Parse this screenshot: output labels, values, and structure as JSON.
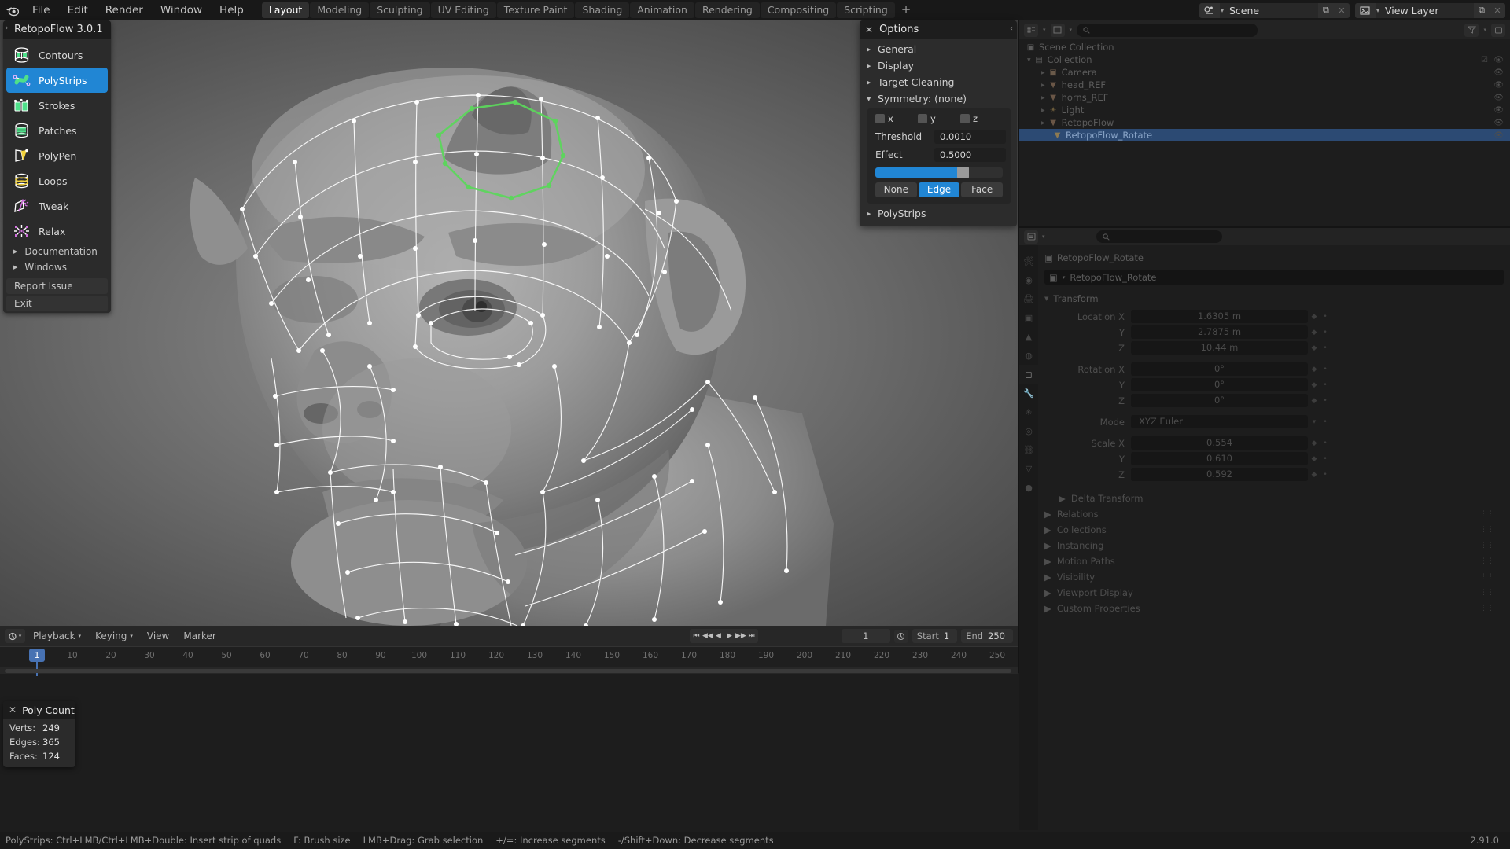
{
  "app": {
    "version": "2.91.0"
  },
  "topbar": {
    "logo_icon": "blender-logo-icon",
    "menus": [
      "File",
      "Edit",
      "Render",
      "Window",
      "Help"
    ],
    "workspace_tabs": [
      {
        "label": "Layout",
        "active": true
      },
      {
        "label": "Modeling",
        "active": false
      },
      {
        "label": "Sculpting",
        "active": false
      },
      {
        "label": "UV Editing",
        "active": false
      },
      {
        "label": "Texture Paint",
        "active": false
      },
      {
        "label": "Shading",
        "active": false
      },
      {
        "label": "Animation",
        "active": false
      },
      {
        "label": "Rendering",
        "active": false
      },
      {
        "label": "Compositing",
        "active": false
      },
      {
        "label": "Scripting",
        "active": false
      }
    ],
    "add_tab_label": "+",
    "scene": {
      "icon": "scene-icon",
      "name": "Scene",
      "copy_icon": "duplicate-icon",
      "close_icon": "x-icon"
    },
    "view_layer": {
      "icon": "view-layer-icon",
      "name": "View Layer",
      "copy_icon": "duplicate-icon",
      "close_icon": "x-icon"
    }
  },
  "retopoflow": {
    "title": "RetopoFlow 3.0.1",
    "tools": [
      {
        "label": "Contours",
        "icon": "contours-icon",
        "active": false
      },
      {
        "label": "PolyStrips",
        "icon": "polystrips-icon",
        "active": true
      },
      {
        "label": "Strokes",
        "icon": "strokes-icon",
        "active": false
      },
      {
        "label": "Patches",
        "icon": "patches-icon",
        "active": false
      },
      {
        "label": "PolyPen",
        "icon": "polypen-icon",
        "active": false
      },
      {
        "label": "Loops",
        "icon": "loops-icon",
        "active": false
      },
      {
        "label": "Tweak",
        "icon": "tweak-icon",
        "active": false
      },
      {
        "label": "Relax",
        "icon": "relax-icon",
        "active": false
      }
    ],
    "sections": [
      {
        "label": "Documentation",
        "icon": "triangle-right-icon"
      },
      {
        "label": "Windows",
        "icon": "triangle-right-icon"
      }
    ],
    "actions": [
      "Report Issue",
      "Exit"
    ]
  },
  "options": {
    "title": "Options",
    "close_icon": "x-icon",
    "collapse_icon": "chevron-left-icon",
    "sections": [
      {
        "label": "General",
        "expanded": false
      },
      {
        "label": "Display",
        "expanded": false
      },
      {
        "label": "Target Cleaning",
        "expanded": false
      },
      {
        "label": "Symmetry: (none)",
        "expanded": true
      }
    ],
    "symmetry": {
      "axes": [
        {
          "label": "x",
          "checked": false
        },
        {
          "label": "y",
          "checked": false
        },
        {
          "label": "z",
          "checked": false
        }
      ],
      "threshold_label": "Threshold",
      "threshold_value": "0.0010",
      "effect_label": "Effect",
      "effect_value": "0.5000",
      "slider_percent": 66,
      "mode_buttons": [
        {
          "label": "None",
          "active": false
        },
        {
          "label": "Edge",
          "active": true
        },
        {
          "label": "Face",
          "active": false
        }
      ]
    },
    "footer_section": {
      "label": "PolyStrips",
      "expanded": false
    },
    "accent_color": "#2186d4"
  },
  "poly_count": {
    "title": "Poly Count",
    "close_icon": "x-icon",
    "rows": [
      {
        "key": "Verts:",
        "value": "249"
      },
      {
        "key": "Edges:",
        "value": "365"
      },
      {
        "key": "Faces:",
        "value": "124"
      }
    ]
  },
  "timeline": {
    "editor_icon": "timeline-editor-icon",
    "menus": [
      "Playback",
      "Keying",
      "View",
      "Marker"
    ],
    "current_frame": "1",
    "start_label": "Start",
    "start_value": "1",
    "end_label": "End",
    "end_value": "250",
    "ticks": [
      "10",
      "20",
      "30",
      "40",
      "50",
      "60",
      "70",
      "80",
      "90",
      "100",
      "110",
      "120",
      "130",
      "140",
      "150",
      "160",
      "170",
      "180",
      "190",
      "200",
      "210",
      "220",
      "230",
      "240",
      "250"
    ],
    "playhead_frame": "1",
    "transport_icons": [
      "jump-start-icon",
      "prev-keyframe-icon",
      "play-reverse-icon",
      "play-icon",
      "next-keyframe-icon",
      "jump-end-icon"
    ],
    "sync_icon": "auto-key-icon"
  },
  "outliner": {
    "editor_icon": "outliner-editor-icon",
    "display_mode_icon": "view-layer-icon",
    "search_icon": "search-icon",
    "filter_icon": "filter-icon",
    "new_collection_icon": "new-collection-icon",
    "rows": [
      {
        "label": "Scene Collection",
        "icon": "scene-collection-icon",
        "indent": 0,
        "selected": false,
        "has_tri": false,
        "eye": true,
        "check": false
      },
      {
        "label": "Collection",
        "icon": "collection-icon",
        "indent": 1,
        "selected": false,
        "has_tri": true,
        "eye": true,
        "check": true
      },
      {
        "label": "Camera",
        "icon": "camera-icon",
        "indent": 2,
        "selected": false,
        "has_tri": true,
        "eye": true,
        "check": false
      },
      {
        "label": "head_REF",
        "icon": "mesh-icon",
        "indent": 2,
        "selected": false,
        "has_tri": true,
        "eye": true,
        "check": false
      },
      {
        "label": "horns_REF",
        "icon": "mesh-icon",
        "indent": 2,
        "selected": false,
        "has_tri": true,
        "eye": true,
        "check": false
      },
      {
        "label": "Light",
        "icon": "light-icon",
        "indent": 2,
        "selected": false,
        "has_tri": true,
        "eye": true,
        "check": false
      },
      {
        "label": "RetopoFlow",
        "icon": "mesh-icon",
        "indent": 2,
        "selected": false,
        "has_tri": true,
        "eye": true,
        "check": false
      },
      {
        "label": "RetopoFlow_Rotate",
        "icon": "mesh-icon",
        "indent": 3,
        "selected": true,
        "has_tri": false,
        "eye": true,
        "check": false
      }
    ]
  },
  "properties": {
    "editor_icon": "properties-editor-icon",
    "search_icon": "search-icon",
    "breadcrumb": "RetopoFlow_Rotate",
    "breadcrumb_icon": "object-icon",
    "object_name": "RetopoFlow_Rotate",
    "tabs": [
      "tool-icon",
      "render-icon",
      "output-icon",
      "view-layer-icon",
      "scene-icon",
      "world-icon",
      "object-icon",
      "modifier-icon",
      "particles-icon",
      "physics-icon",
      "constraints-icon",
      "data-icon",
      "material-icon"
    ],
    "transform": {
      "label": "Transform",
      "rows": [
        {
          "label": "Location X",
          "value": "1.6305 m"
        },
        {
          "label": "Y",
          "value": "2.7875 m"
        },
        {
          "label": "Z",
          "value": "10.44 m"
        },
        {
          "label": "Rotation X",
          "value": "0°"
        },
        {
          "label": "Y",
          "value": "0°"
        },
        {
          "label": "Z",
          "value": "0°"
        },
        {
          "label": "Mode",
          "value": "XYZ Euler"
        },
        {
          "label": "Scale X",
          "value": "0.554"
        },
        {
          "label": "Y",
          "value": "0.610"
        },
        {
          "label": "Z",
          "value": "0.592"
        }
      ]
    },
    "sections": [
      "Delta Transform",
      "Relations",
      "Collections",
      "Instancing",
      "Motion Paths",
      "Visibility",
      "Viewport Display",
      "Custom Properties"
    ]
  },
  "status_bar": {
    "items": [
      "PolyStrips: Ctrl+LMB/Ctrl+LMB+Double: Insert strip of quads",
      "F: Brush size",
      "LMB+Drag: Grab selection",
      "+/=: Increase segments",
      "-/Shift+Down: Decrease segments"
    ],
    "version": "2.91.0"
  },
  "viewport": {
    "subject": "ogre-head-sculpt",
    "retopo_color": "#ffffff",
    "active_strip_color": "#5cd65c"
  }
}
